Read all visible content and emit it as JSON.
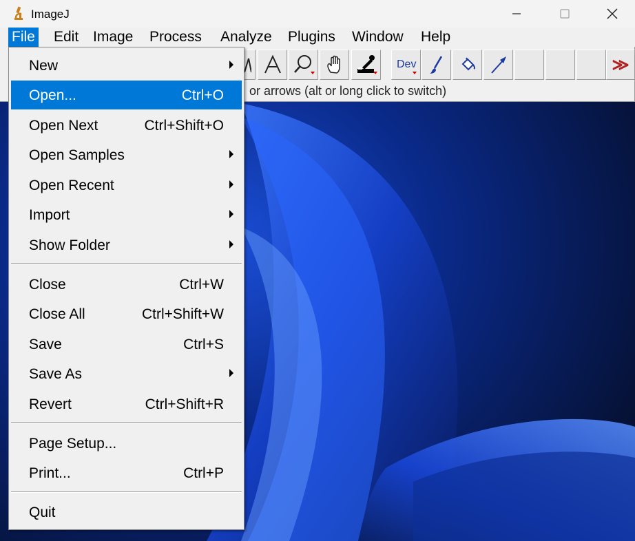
{
  "window": {
    "title": "ImageJ"
  },
  "menubar": [
    {
      "label": "File",
      "active": true
    },
    {
      "label": "Edit"
    },
    {
      "label": "Image"
    },
    {
      "label": "Process"
    },
    {
      "label": "Analyze"
    },
    {
      "label": "Plugins"
    },
    {
      "label": "Window"
    },
    {
      "label": "Help"
    }
  ],
  "toolbar": {
    "tools": [
      {
        "icon": "angle-icon"
      },
      {
        "icon": "text-tool-icon"
      },
      {
        "icon": "magnifier-icon"
      },
      {
        "icon": "hand-scroll-icon"
      },
      {
        "icon": "color-picker-icon"
      },
      {
        "icon": "dev-tool-icon",
        "label": "Dev"
      },
      {
        "icon": "brush-icon"
      },
      {
        "icon": "flood-fill-icon"
      },
      {
        "icon": "arrow-tool-icon"
      },
      {
        "icon": "empty-slot"
      },
      {
        "icon": "empty-slot"
      },
      {
        "icon": "empty-slot"
      },
      {
        "icon": "more-tools-icon",
        "label": "≫"
      }
    ],
    "status": "or arrows (alt or long click to switch)"
  },
  "file_menu": {
    "groups": [
      [
        {
          "label": "New",
          "submenu": true
        },
        {
          "label": "Open...",
          "shortcut": "Ctrl+O",
          "highlight": true
        },
        {
          "label": "Open Next",
          "shortcut": "Ctrl+Shift+O"
        },
        {
          "label": "Open Samples",
          "submenu": true
        },
        {
          "label": "Open Recent",
          "submenu": true
        },
        {
          "label": "Import",
          "submenu": true
        },
        {
          "label": "Show Folder",
          "submenu": true
        }
      ],
      [
        {
          "label": "Close",
          "shortcut": "Ctrl+W"
        },
        {
          "label": "Close All",
          "shortcut": "Ctrl+Shift+W"
        },
        {
          "label": "Save",
          "shortcut": "Ctrl+S"
        },
        {
          "label": "Save As",
          "submenu": true
        },
        {
          "label": "Revert",
          "shortcut": "Ctrl+Shift+R"
        }
      ],
      [
        {
          "label": "Page Setup..."
        },
        {
          "label": "Print...",
          "shortcut": "Ctrl+P"
        }
      ],
      [
        {
          "label": "Quit"
        }
      ]
    ]
  },
  "colors": {
    "highlight": "#0078d7",
    "menu_bg": "#f0f0f0",
    "accent_red": "#b22222"
  }
}
